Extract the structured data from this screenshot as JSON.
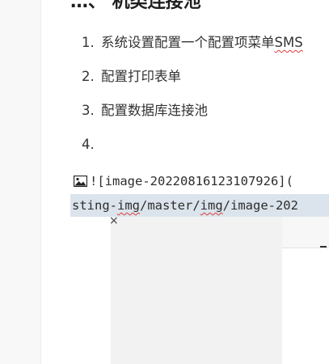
{
  "document": {
    "heading": "…、 机类连接池",
    "list": [
      {
        "num": "1.",
        "text_plain": "系统设置配置一个配置项菜单",
        "text_marked": "SMS"
      },
      {
        "num": "2.",
        "text_plain": "配置打印表单",
        "text_marked": ""
      },
      {
        "num": "3.",
        "text_plain": "配置数据库连接池",
        "text_marked": ""
      },
      {
        "num": "4.",
        "text_plain": "",
        "text_marked": ""
      }
    ],
    "markdown_line1": "![image-20220816123107926](",
    "markdown_line2": {
      "part1": "sting-",
      "part2": "img",
      "part3": "/master/",
      "part4": "img",
      "part5": "/image-202"
    },
    "close_mark": "×"
  },
  "colors": {
    "selection": "#dbe4ec",
    "spellcheck": "#e23b3b"
  },
  "icons": {
    "image_icon": "image-icon"
  }
}
